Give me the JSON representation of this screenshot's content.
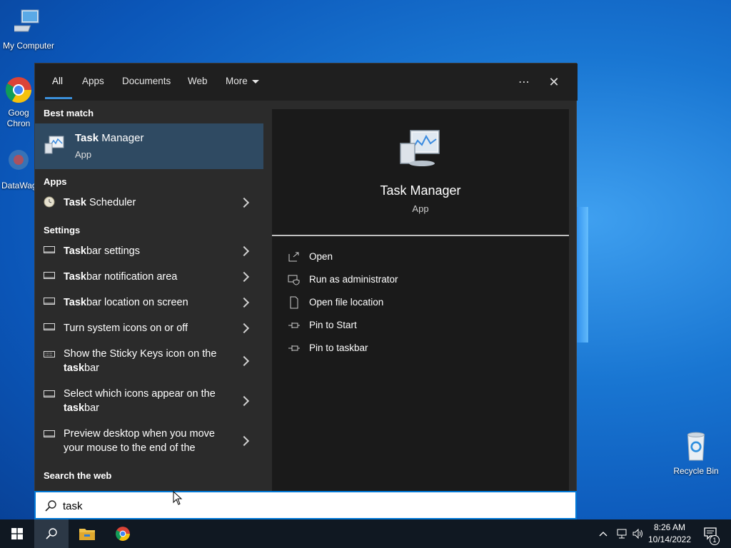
{
  "desktop": {
    "icons": [
      {
        "label": "My Computer"
      },
      {
        "label": "Goog\nChron"
      },
      {
        "label": "DataWag"
      },
      {
        "label": "Recycle Bin"
      }
    ]
  },
  "search": {
    "tabs": [
      {
        "label": "All",
        "active": true
      },
      {
        "label": "Apps"
      },
      {
        "label": "Documents"
      },
      {
        "label": "Web"
      },
      {
        "label": "More"
      }
    ],
    "more_options_glyph": "⋯",
    "close_glyph": "✕",
    "best_match_header": "Best match",
    "best_match": {
      "title_bold": "Task",
      "title_rest": " Manager",
      "subtitle": "App"
    },
    "apps_header": "Apps",
    "apps": [
      {
        "bold": "Task",
        "rest": " Scheduler"
      }
    ],
    "settings_header": "Settings",
    "settings": [
      {
        "line1_bold": "Task",
        "line1_rest": "bar settings"
      },
      {
        "line1_bold": "Task",
        "line1_rest": "bar notification area"
      },
      {
        "line1_bold": "Task",
        "line1_rest": "bar location on screen"
      },
      {
        "line1_bold": "",
        "line1_rest": "Turn system icons on or off"
      },
      {
        "line1_bold": "",
        "line1_rest": "Show the Sticky Keys icon on the",
        "line2_bold": "task",
        "line2_rest": "bar"
      },
      {
        "line1_bold": "",
        "line1_rest": "Select which icons appear on the",
        "line2_bold": "task",
        "line2_rest": "bar"
      },
      {
        "line1_bold": "",
        "line1_rest": "Preview desktop when you move",
        "line2_bold": "",
        "line2_rest": "your mouse to the end of the"
      }
    ],
    "search_web_header": "Search the web",
    "preview": {
      "title": "Task Manager",
      "subtitle": "App",
      "actions": [
        {
          "label": "Open",
          "icon": "open-icon"
        },
        {
          "label": "Run as administrator",
          "icon": "shield-icon"
        },
        {
          "label": "Open file location",
          "icon": "file-location-icon"
        },
        {
          "label": "Pin to Start",
          "icon": "pin-icon"
        },
        {
          "label": "Pin to taskbar",
          "icon": "pin-icon"
        }
      ]
    },
    "query": "task"
  },
  "taskbar": {
    "time": "8:26 AM",
    "date": "10/14/2022",
    "notification_count": "1"
  },
  "colors": {
    "accent": "#0078d7",
    "best_match_bg": "#2f4a62",
    "pane_bg": "#2b2b2b",
    "preview_bg": "#1a1a1a",
    "taskbar_bg": "#101822"
  }
}
